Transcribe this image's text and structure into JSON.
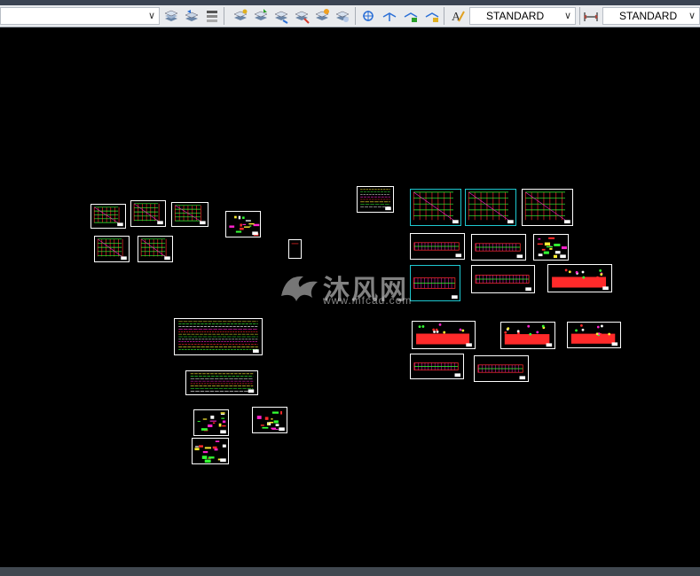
{
  "toolbar": {
    "layer_combo_value": "",
    "text_style": "STANDARD",
    "dim_style": "STANDARD"
  },
  "watermark": {
    "text": "沐风网",
    "url": "www.mfcad.com"
  },
  "colors": {
    "ribbon": "#3b4453",
    "toolbar_bg": "#e9ebee",
    "canvas": "#000000",
    "sheet_border": "#ffffff",
    "sheet_border_cyan": "#1ec8d0",
    "drawing_red": "#ff2a2a",
    "drawing_green": "#33ff33",
    "drawing_magenta": "#ff22cc",
    "drawing_yellow": "#ffee33"
  },
  "icons": [
    "layer-states-icon",
    "layer-previous-icon",
    "layer-properties-icon",
    "match-layer-icon",
    "layer-walk-icon",
    "layer-isolate-icon",
    "layer-unisolate-icon",
    "layer-freeze-icon",
    "layer-off-icon",
    "layer-lock-icon",
    "layer-unlock-icon",
    "text-style-icon",
    "dim-style-icon"
  ]
}
